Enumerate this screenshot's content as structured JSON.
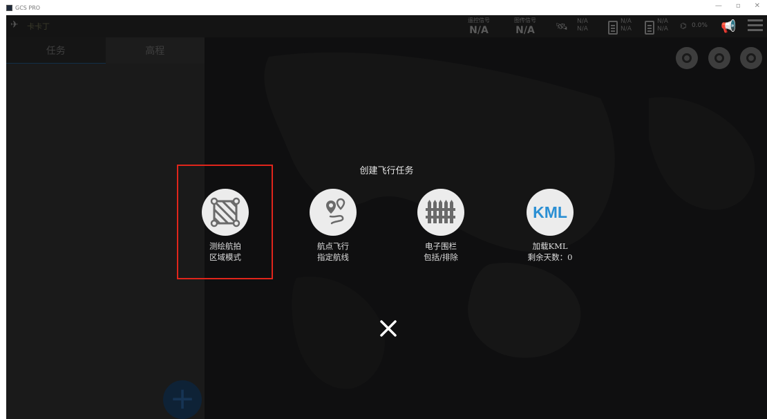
{
  "window": {
    "title": "GCS PRO",
    "min_glyph": "—",
    "max_glyph": "▫",
    "close_glyph": "✕"
  },
  "status_bar": {
    "logo_icon": "drone-icon",
    "brand": "卡卡丁",
    "remote_signal": {
      "label": "遥控信号",
      "value": "N/A"
    },
    "image_signal": {
      "label": "图传信号",
      "value": "N/A"
    },
    "gps": {
      "line1": "N/A",
      "line2": "N/A"
    },
    "battery1": {
      "line1": "N/A",
      "line2": "N/A"
    },
    "battery2": {
      "line1": "N/A",
      "line2": "N/A"
    },
    "flow": "0.0%"
  },
  "left_panel": {
    "tabs": [
      {
        "label": "任务"
      },
      {
        "label": "高程"
      }
    ],
    "add_label": "+"
  },
  "dialog": {
    "title": "创建飞行任务",
    "options": [
      {
        "icon": "survey-area-icon",
        "line1": "测绘航拍",
        "line2": "区域模式"
      },
      {
        "icon": "waypoint-route-icon",
        "line1": "航点飞行",
        "line2": "指定航线"
      },
      {
        "icon": "fence-icon",
        "line1": "电子围栏",
        "line2": "包括/排除"
      },
      {
        "icon": "kml-icon",
        "icon_text": "KML",
        "line1": "加载KML",
        "line2": "剩余天数：0"
      }
    ],
    "close_glyph": "✕"
  },
  "colors": {
    "highlight": "#e1251b",
    "kml_blue": "#2b8fd3"
  }
}
